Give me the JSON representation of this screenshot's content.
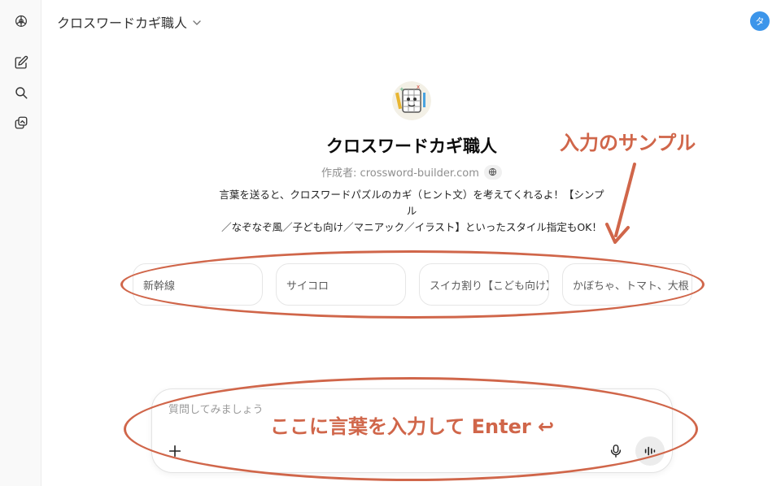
{
  "header": {
    "title": "クロスワードカギ職人",
    "avatar_initial": "タ"
  },
  "sidebar": {
    "items": [
      "openai-logo",
      "new-chat",
      "search",
      "library"
    ]
  },
  "gpt": {
    "name": "クロスワードカギ職人",
    "author_label": "作成者: crossword-builder.com",
    "description_line1": "言葉を送ると、クロスワードパズルのカギ（ヒント文）を考えてくれるよ！【シンプル",
    "description_line2": "／なぞなぞ風／子ども向け／マニアック／イラスト】といったスタイル指定もOK！"
  },
  "starters": [
    {
      "label": "新幹線"
    },
    {
      "label": "サイコロ"
    },
    {
      "label": "スイカ割り【こども向け】"
    },
    {
      "label": "かぼちゃ、トマト、大根"
    }
  ],
  "composer": {
    "placeholder": "質問してみましょう"
  },
  "annotations": {
    "sample_label": "入力のサンプル",
    "enter_label": "ここに言葉を入力して Enter ↩",
    "color": "#d0664a"
  },
  "colors": {
    "accent": "#3c95ea",
    "annotation": "#d0664a"
  }
}
